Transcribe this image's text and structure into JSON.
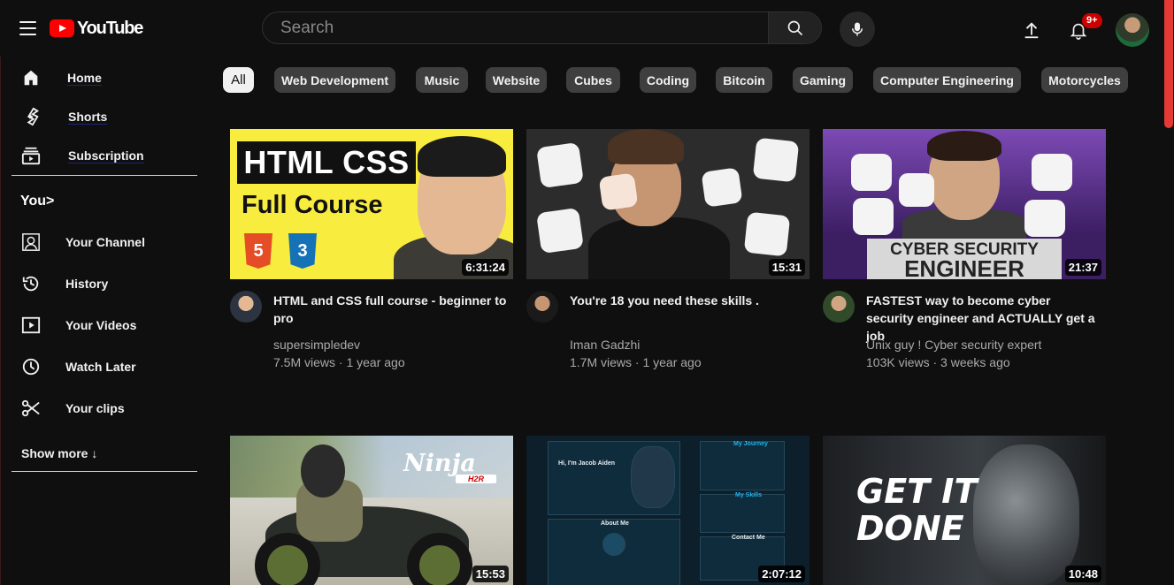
{
  "header": {
    "logo_text": "YouTube",
    "search_placeholder": "Search",
    "notification_badge": "9+",
    "brand_color": "#ff0000"
  },
  "sidebar": {
    "main": [
      {
        "label": "Home",
        "icon": "home-icon"
      },
      {
        "label": "Shorts",
        "icon": "shorts-icon"
      },
      {
        "label": "Subscription",
        "icon": "subscriptions-icon"
      }
    ],
    "you_heading": "You>",
    "you_items": [
      {
        "label": "Your Channel",
        "icon": "user-icon"
      },
      {
        "label": "History",
        "icon": "history-icon"
      },
      {
        "label": "Your Videos",
        "icon": "video-icon"
      },
      {
        "label": "Watch Later",
        "icon": "clock-icon"
      },
      {
        "label": "Your clips",
        "icon": "scissors-icon"
      }
    ],
    "show_more": "Show more ↓"
  },
  "chips": [
    "All",
    "Web Development",
    "Music",
    "Website",
    "Cubes",
    "Coding",
    "Bitcoin",
    "Gaming",
    "Computer Engineering",
    "Motorcycles"
  ],
  "videos": [
    {
      "title": "HTML and CSS full course - beginner to pro",
      "channel": "supersimpledev",
      "stats": "7.5M views · 1 year ago",
      "duration": "6:31:24",
      "thumb_text": {
        "headline": "HTML CSS",
        "sub": "Full Course",
        "badge1": "5",
        "badge2": "3"
      }
    },
    {
      "title": "You're 18 you need these skills .",
      "channel": "Iman Gadzhi",
      "stats": "1.7M views · 1 year ago",
      "duration": "15:31"
    },
    {
      "title": "FASTEST way to become cyber security engineer and ACTUALLY get a job",
      "channel": "Unix guy ! Cyber security expert",
      "stats": "103K views · 3 weeks ago",
      "duration": "21:37",
      "thumb_text": {
        "line1": "CYBER SECURITY",
        "line2": "ENGINEER"
      }
    },
    {
      "duration": "15:53",
      "thumb_text": {
        "brand": "Ninja",
        "model": "H2R"
      }
    },
    {
      "duration": "2:07:12",
      "thumb_text": {
        "hero": "Hi, I'm Jacob Aiden",
        "about": "About Me",
        "journey": "My Journey",
        "skills": "My Skills",
        "contact": "Contact Me"
      }
    },
    {
      "duration": "10:48",
      "thumb_text": {
        "headline1": "GET IT",
        "headline2": "DONE"
      }
    }
  ]
}
